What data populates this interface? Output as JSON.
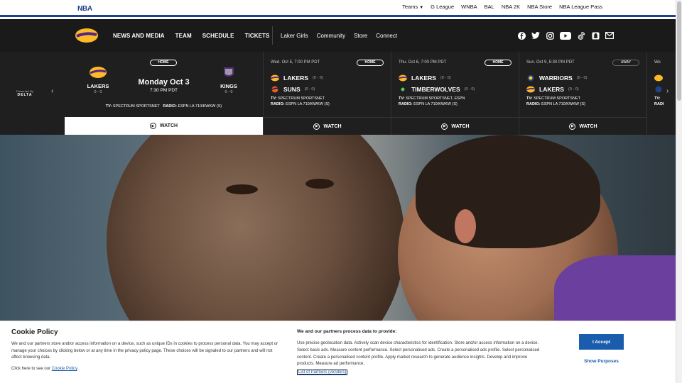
{
  "league_bar": {
    "logo_text": "NBA",
    "links": [
      "Teams",
      "G League",
      "WNBA",
      "BAL",
      "NBA 2K",
      "NBA Store",
      "NBA League Pass"
    ]
  },
  "team_nav": {
    "main_links": [
      "NEWS AND MEDIA",
      "TEAM",
      "SCHEDULE",
      "TICKETS"
    ],
    "sub_links": [
      "Laker Girls",
      "Community",
      "Store",
      "Connect"
    ],
    "social_icons": [
      "facebook-icon",
      "twitter-icon",
      "instagram-icon",
      "youtube-icon",
      "tiktok-icon",
      "snapchat-icon",
      "email-icon"
    ]
  },
  "schedule": {
    "sponsor_top": "Presented By",
    "sponsor_name": "DELTA",
    "featured": {
      "badge": "HOME",
      "home_team": "LAKERS",
      "home_record": "0 - 0",
      "away_team": "KINGS",
      "away_record": "0 - 0",
      "date": "Monday Oct 3",
      "time": "7:30 PM PDT",
      "tv_label": "TV:",
      "tv": "SPECTRUM SPORTSNET",
      "radio_label": "RADIO:",
      "radio": "ESPN LA 710/KWKW (S)",
      "watch": "WATCH"
    },
    "games": [
      {
        "date": "Wed. Oct 5, 7:00 PM PDT",
        "badge": "HOME",
        "team1": "LAKERS",
        "rec1": "(0 - 0)",
        "team2": "SUNS",
        "rec2": "(0 - 0)",
        "tv": "SPECTRUM SPORTSNET",
        "radio": "ESPN LA 710/KWKW (S)",
        "watch": "WATCH"
      },
      {
        "date": "Thu. Oct 6, 7:00 PM PDT",
        "badge": "HOME",
        "team1": "LAKERS",
        "rec1": "(0 - 0)",
        "team2": "TIMBERWOLVES",
        "rec2": "(0 - 0)",
        "tv": "SPECTRUM SPORTSNET, ESPN",
        "radio": "ESPN LA 710/KWKW (S)",
        "watch": "WATCH"
      },
      {
        "date": "Sun. Oct 9, 5:30 PM PDT",
        "badge": "AWAY",
        "team1": "WARRIORS",
        "rec1": "(0 - 0)",
        "team2": "LAKERS",
        "rec2": "(0 - 0)",
        "tv": "SPECTRUM SPORTSNET",
        "radio": "ESPN LA 710/KWKW (S)",
        "watch": "WATCH"
      }
    ],
    "partial_date": "We",
    "partial_tv": "TV:",
    "partial_radio": "RADI"
  },
  "cookie": {
    "title": "Cookie Policy",
    "text": "We and our partners store and/or access information on a device, such as unique IDs in cookies to process personal data. You may accept or manage your choices by clicking below or at any time in the privacy policy page. These choices will be signaled to our partners and will not affect browsing data.",
    "link_prefix": "Click here to see our",
    "link_text": "Cookie Policy",
    "partners_heading": "We and our partners process data to provide:",
    "partners_text": "Use precise geolocation data. Actively scan device characteristics for identification. Store and/or access information on a device. Select basic ads. Measure content performance. Select personalised ads. Create a personalised ads profile. Select personalised content. Create a personalised content profile. Apply market research to generate audience insights. Develop and improve products. Measure ad performance.",
    "vendors_link": "List of Partners (vendors)",
    "accept": "I Accept",
    "purposes": "Show Purposes"
  },
  "colors": {
    "nba_blue": "#1d428a",
    "lakers_purple": "#552583",
    "lakers_gold": "#fdb927",
    "accept_blue": "#1a5dad"
  }
}
